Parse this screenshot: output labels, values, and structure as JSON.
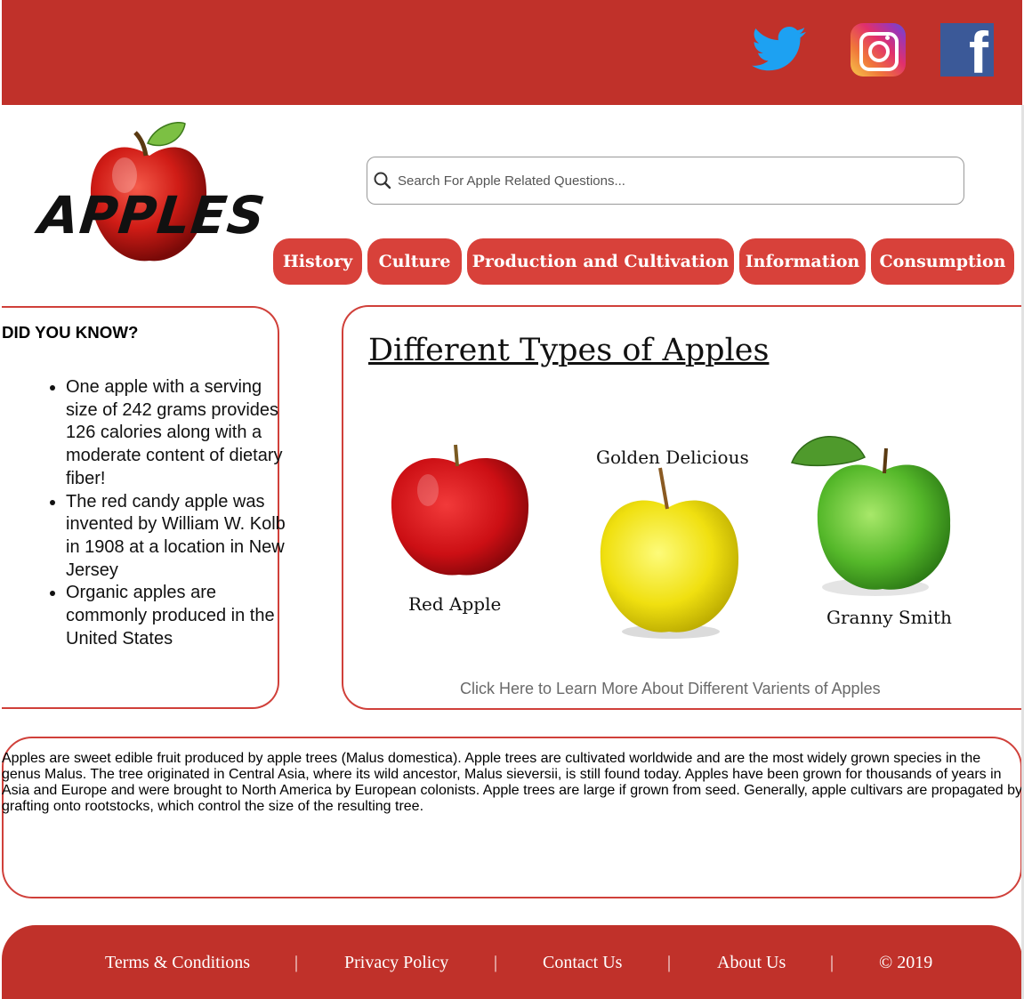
{
  "social": {
    "twitter": "twitter-icon",
    "instagram": "instagram-icon",
    "facebook": "facebook-icon"
  },
  "brand": {
    "logo_text": "APPLES"
  },
  "search": {
    "placeholder": "Search For Apple Related Questions..."
  },
  "nav": [
    "History",
    "Culture",
    "Production and Cultivation",
    "Information",
    "Consumption"
  ],
  "did_you_know": {
    "title": "DID YOU KNOW?",
    "facts": [
      "One apple with a serving size of 242 grams provides 126 calories along with a moderate content of dietary fiber!",
      "The red candy apple was invented by William W. Kolb in 1908 at a location in New Jersey",
      "Organic apples are commonly produced in the United States"
    ]
  },
  "types": {
    "title": "Different Types of Apples",
    "apples": [
      "Red Apple",
      "Golden Delicious",
      "Granny Smith"
    ],
    "link": "Click Here to Learn More About Different Varients of Apples"
  },
  "about": {
    "text": "Apples are sweet edible fruit produced by apple trees (Malus domestica). Apple trees are cultivated worldwide and are the most widely grown species in the genus Malus. The tree originated in Central Asia, where its wild ancestor, Malus sieversii, is still found today. Apples have been grown for thousands of years in Asia and Europe and were brought to North America by European colonists. Apple trees are large if grown from seed. Generally, apple cultivars are propagated by grafting onto rootstocks, which control the size of the resulting tree."
  },
  "footer": {
    "links": [
      "Terms & Conditions",
      "Privacy Policy",
      "Contact Us",
      "About Us",
      "© 2019"
    ],
    "separator": "|"
  },
  "colors": {
    "brand_red": "#c0312a",
    "nav_red": "#d8413a",
    "border_red": "#d0403a"
  }
}
